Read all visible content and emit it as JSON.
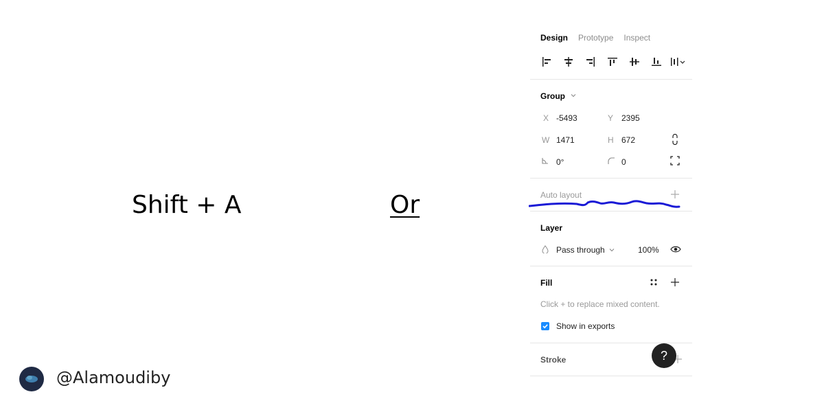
{
  "slide": {
    "shortcut_text": "Shift + A",
    "or_text": "Or",
    "handle": "@Alamoudiby"
  },
  "panel": {
    "tabs": [
      "Design",
      "Prototype",
      "Inspect"
    ],
    "align_icons": [
      "align-left-icon",
      "align-horizontal-center-icon",
      "align-right-icon",
      "align-top-icon",
      "align-vertical-center-icon",
      "align-bottom-icon",
      "distribute-icon"
    ],
    "group": {
      "title": "Group",
      "x_label": "X",
      "x_value": "-5493",
      "y_label": "Y",
      "y_value": "2395",
      "w_label": "W",
      "w_value": "1471",
      "h_label": "H",
      "h_value": "672",
      "rotation_value": "0°",
      "radius_value": "0"
    },
    "auto_layout": {
      "title": "Auto layout",
      "annotation_color": "#1a1ad6"
    },
    "layer": {
      "title": "Layer",
      "blend_mode": "Pass through",
      "opacity": "100%"
    },
    "fill": {
      "title": "Fill",
      "hint": "Click + to replace mixed content.",
      "show_in_exports": "Show in exports",
      "show_in_exports_checked": true
    },
    "stroke": {
      "title": "Stroke"
    },
    "help_label": "?",
    "accent_color": "#1a8cff"
  }
}
